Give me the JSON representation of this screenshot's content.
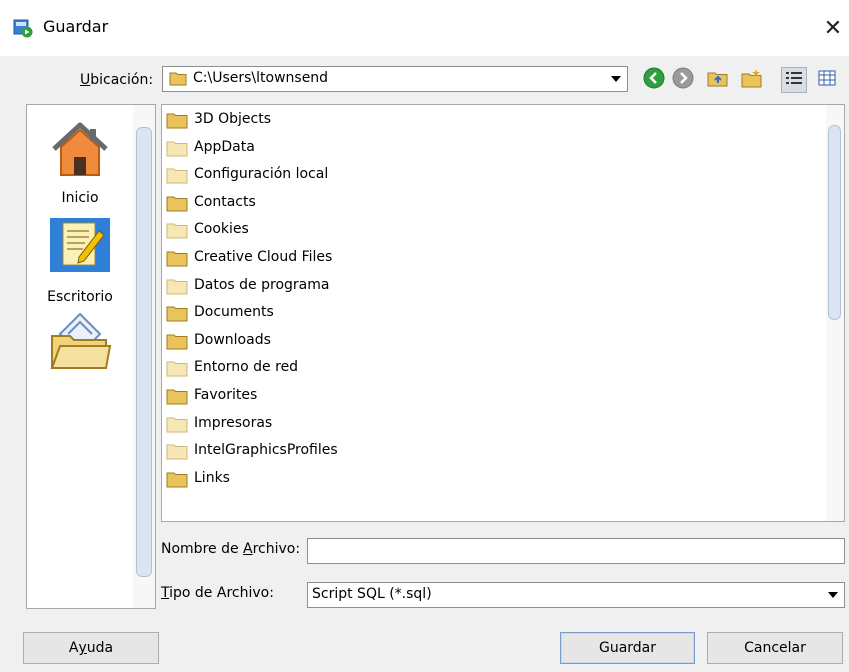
{
  "window": {
    "title": "Guardar"
  },
  "location": {
    "label_mnemonic": "U",
    "label_rest": "bicación:",
    "path": "C:\\Users\\ltownsend"
  },
  "shortcuts": [
    {
      "label": "Inicio",
      "icon": "home-icon"
    },
    {
      "label": "",
      "icon": "document-edit-icon"
    },
    {
      "label": "Escritorio",
      "icon": "desktop-folder-icon"
    }
  ],
  "toolbar": {
    "icons": [
      "back-icon",
      "forward-icon",
      "up-folder-icon",
      "new-folder-icon",
      "list-view-icon",
      "details-view-icon"
    ]
  },
  "files": [
    {
      "name": "3D Objects",
      "type": "folder"
    },
    {
      "name": "AppData",
      "type": "folder-light"
    },
    {
      "name": "Configuración local",
      "type": "folder-light"
    },
    {
      "name": "Contacts",
      "type": "folder"
    },
    {
      "name": "Cookies",
      "type": "folder-light"
    },
    {
      "name": "Creative Cloud Files",
      "type": "folder"
    },
    {
      "name": "Datos de programa",
      "type": "folder-light"
    },
    {
      "name": "Documents",
      "type": "folder"
    },
    {
      "name": "Downloads",
      "type": "folder"
    },
    {
      "name": "Entorno de red",
      "type": "folder-light"
    },
    {
      "name": "Favorites",
      "type": "folder"
    },
    {
      "name": "Impresoras",
      "type": "folder-light"
    },
    {
      "name": "IntelGraphicsProfiles",
      "type": "folder-light"
    },
    {
      "name": "Links",
      "type": "folder"
    }
  ],
  "filename": {
    "label_pre": "Nombre de ",
    "label_mnemonic": "A",
    "label_post": "rchivo:",
    "value": ""
  },
  "filetype": {
    "label_mnemonic": "T",
    "label_rest": "ipo de Archivo:",
    "value": "Script SQL (*.sql)"
  },
  "buttons": {
    "help_pre": "A",
    "help_mnemonic": "y",
    "help_post": "uda",
    "save": "Guardar",
    "cancel": "Cancelar"
  },
  "colors": {
    "folder": "#e9c45c",
    "folder_light": "#f6e7b4",
    "accent": "#7a9cc9"
  }
}
